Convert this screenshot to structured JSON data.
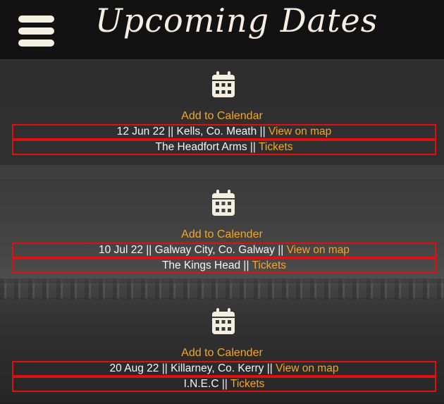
{
  "header": {
    "title": "Upcoming Dates",
    "menu_icon": "hamburger-menu-icon"
  },
  "events": [
    {
      "add_label": "Add to Calendar",
      "date": "12 Jun 22",
      "location": "Kells, Co. Meath",
      "map_label": "View on map",
      "venue": "The Headfort Arms",
      "tickets_label": "Tickets",
      "sep": "||"
    },
    {
      "add_label": "Add to Calender",
      "date": "10 Jul 22",
      "location": "Galway City, Co. Galway",
      "map_label": "View on map",
      "venue": "The Kings Head",
      "tickets_label": "Tickets",
      "sep": "||"
    },
    {
      "add_label": "Add to Calender",
      "date": "20 Aug 22",
      "location": "Killarney, Co. Kerry",
      "map_label": "View on map",
      "venue": "I.N.E.C",
      "tickets_label": "Tickets",
      "sep": "||"
    }
  ],
  "colors": {
    "accent": "#f5a623",
    "border": "#e01010",
    "header_bg": "#121212",
    "text": "#f5f5f5"
  },
  "icons": {
    "calendar": "calendar-icon"
  }
}
